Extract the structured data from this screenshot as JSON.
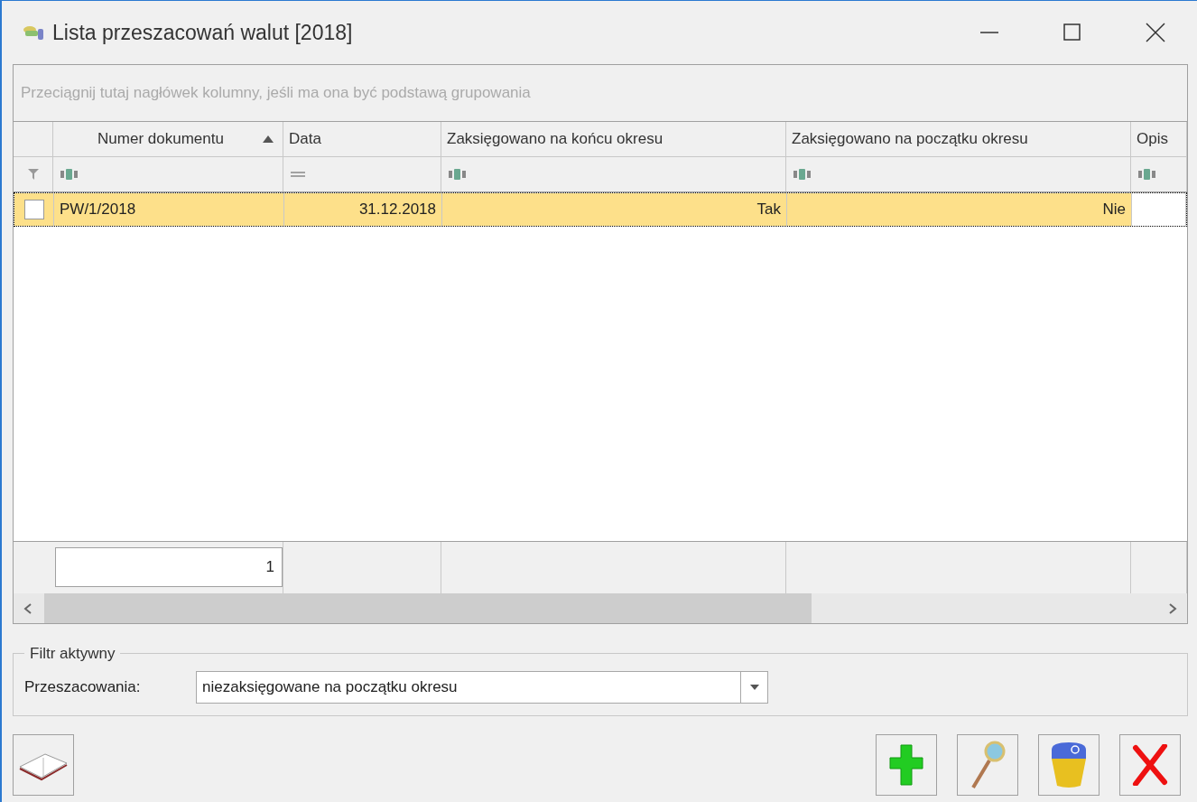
{
  "window": {
    "title": "Lista przeszacowań walut [2018]"
  },
  "grid": {
    "group_panel_hint": "Przeciągnij tutaj nagłówek kolumny, jeśli ma ona być podstawą grupowania",
    "columns": [
      {
        "label": "Numer dokumentu",
        "sorted": true,
        "kind": "text"
      },
      {
        "label": "Data",
        "sorted": false,
        "kind": "date"
      },
      {
        "label": "Zaksięgowano na końcu okresu",
        "sorted": false,
        "kind": "text"
      },
      {
        "label": "Zaksięgowano na początku okresu",
        "sorted": false,
        "kind": "text"
      },
      {
        "label": "Opis",
        "sorted": false,
        "kind": "text"
      }
    ],
    "rows": [
      {
        "selected": true,
        "checked": false,
        "cells": [
          "PW/1/2018",
          "31.12.2018",
          "Tak",
          "Nie",
          null
        ]
      }
    ],
    "footer": {
      "count": "1"
    }
  },
  "filter_group": {
    "title": "Filtr aktywny",
    "label": "Przeszacowania:",
    "value": "niezaksięgowane na początku okresu"
  },
  "buttons": [
    {
      "kind": "book"
    },
    {
      "kind": "add"
    },
    {
      "kind": "preview"
    },
    {
      "kind": "trash"
    },
    {
      "kind": "close"
    }
  ]
}
